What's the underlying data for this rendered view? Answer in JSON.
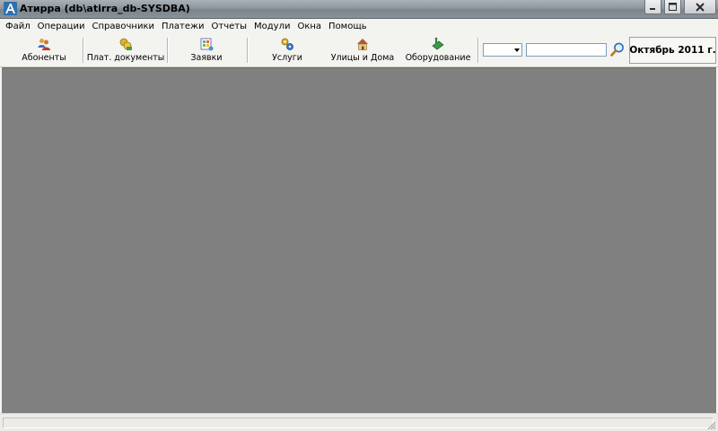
{
  "window": {
    "title": "Атирра (db\\atirra_db-SYSDBA)"
  },
  "menu": {
    "items": [
      "Файл",
      "Операции",
      "Справочники",
      "Платежи",
      "Отчеты",
      "Модули",
      "Окна",
      "Помощь"
    ]
  },
  "toolbar": {
    "buttons": [
      {
        "label": "Абоненты",
        "icon": "subscribers-icon"
      },
      {
        "label": "Плат. документы",
        "icon": "payment-documents-icon"
      },
      {
        "label": "Заявки",
        "icon": "requests-icon"
      },
      {
        "label": "Услуги",
        "icon": "services-icon"
      },
      {
        "label": "Улицы и Дома",
        "icon": "streets-houses-icon"
      },
      {
        "label": "Оборудование",
        "icon": "equipment-icon"
      }
    ],
    "search": {
      "type_value": "",
      "query_value": ""
    },
    "period_label": "Октябрь 2011 г."
  },
  "colors": {
    "titlebar": "#8f979e",
    "workspace": "#808080",
    "chrome": "#f3f3f0"
  }
}
